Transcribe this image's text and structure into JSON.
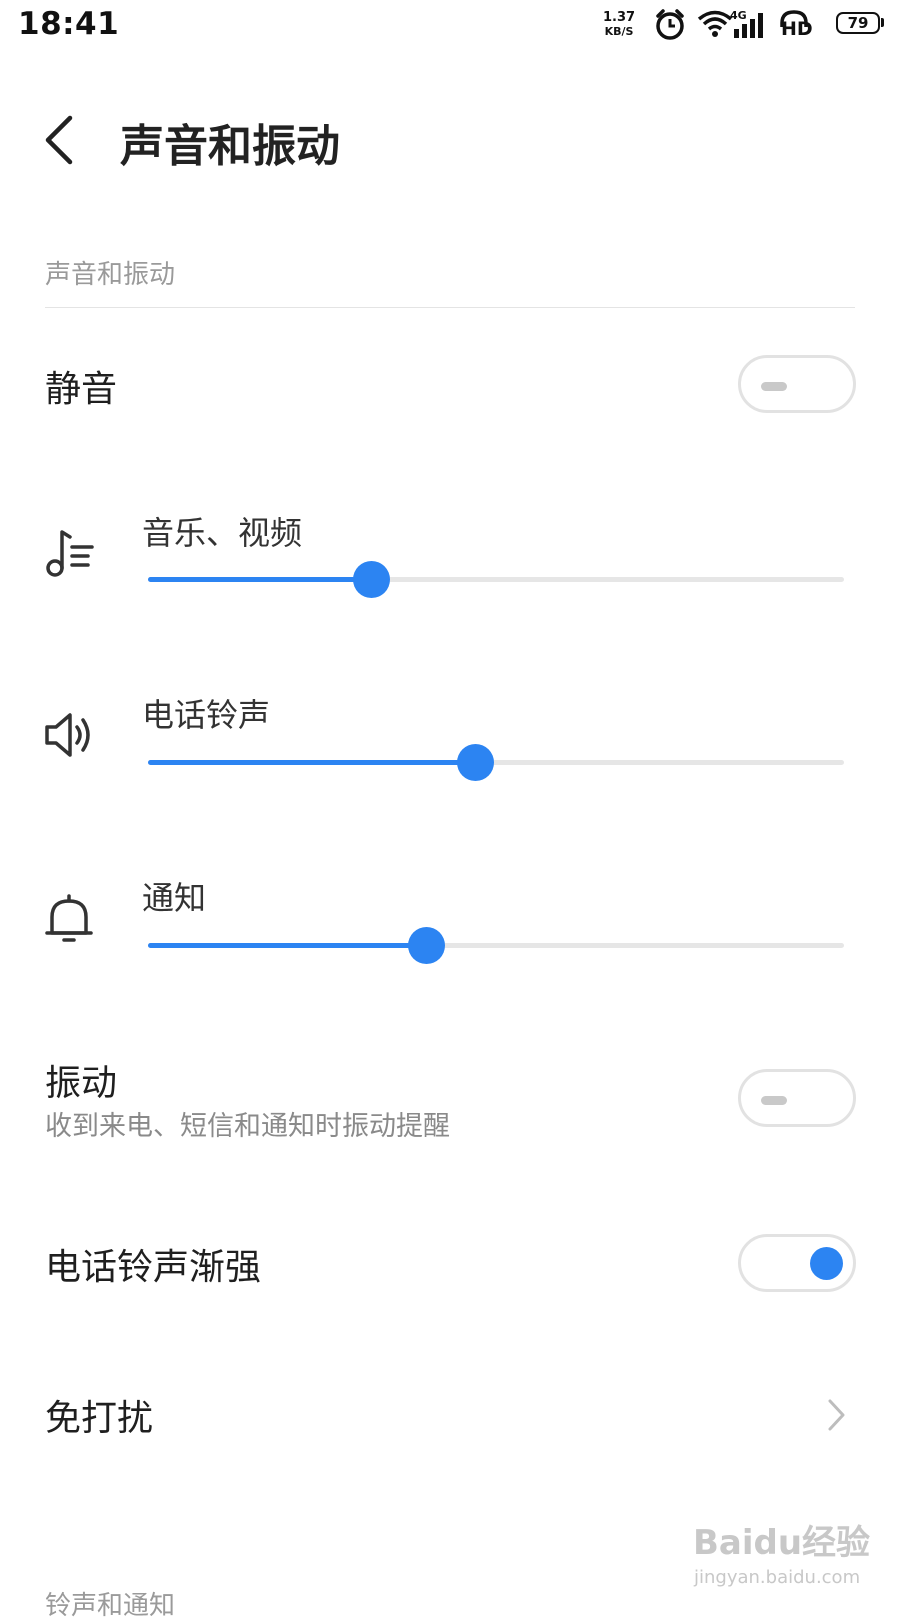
{
  "status_bar": {
    "time": "18:41",
    "net_speed_value": "1.37",
    "net_speed_unit": "KB/S",
    "network_type": "4G",
    "hd_label": "HD",
    "battery": "79"
  },
  "header": {
    "title": "声音和振动",
    "back_icon": "chevron-left-icon"
  },
  "section_header": "声音和振动",
  "mute": {
    "label": "静音",
    "on": false
  },
  "volumes": [
    {
      "label": "音乐、视频",
      "icon": "music-note-icon",
      "level": 0.32
    },
    {
      "label": "电话铃声",
      "icon": "speaker-icon",
      "level": 0.47
    },
    {
      "label": "通知",
      "icon": "bell-icon",
      "level": 0.4
    }
  ],
  "vibration": {
    "label": "振动",
    "sublabel": "收到来电、短信和通知时振动提醒",
    "on": false
  },
  "ringtone_crescendo": {
    "label": "电话铃声渐强",
    "on": true
  },
  "do_not_disturb": {
    "label": "免打扰",
    "icon": "chevron-right-icon"
  },
  "section_header_2": "铃声和通知",
  "watermark": {
    "brand": "Baidu经验",
    "url": "jingyan.baidu.com"
  },
  "colors": {
    "accent": "#2c84f2",
    "track": "#e6e6e6",
    "toggle_border": "#e2e2e2"
  }
}
